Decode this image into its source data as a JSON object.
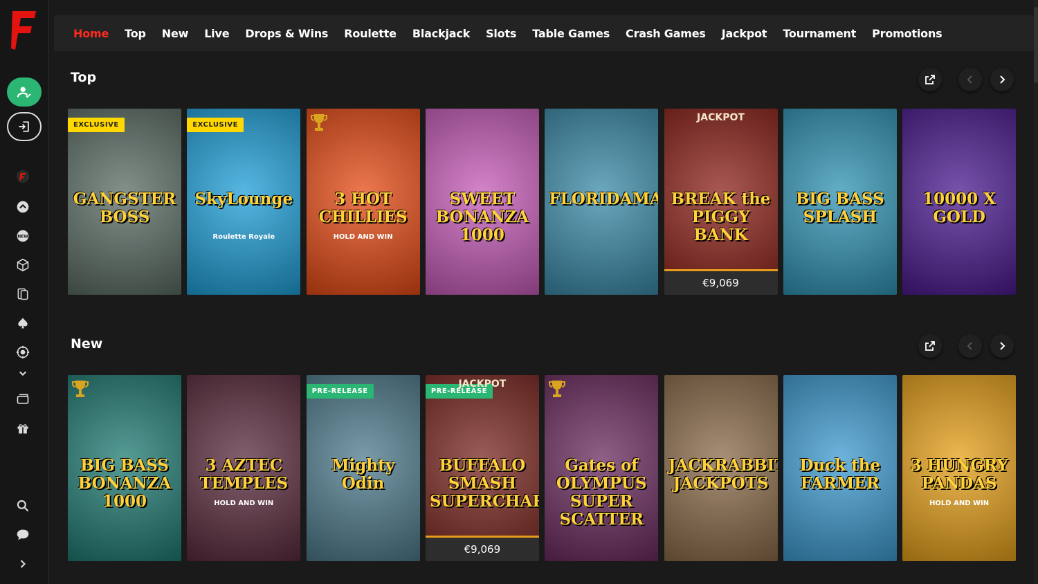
{
  "nav": {
    "items": [
      "Home",
      "Top",
      "New",
      "Live",
      "Drops & Wins",
      "Roulette",
      "Blackjack",
      "Slots",
      "Table Games",
      "Crash Games",
      "Jackpot",
      "Tournament",
      "Promotions"
    ],
    "active": "Home"
  },
  "sidebar": {
    "logo_letter": "F",
    "icons": [
      "account-icon",
      "login-icon",
      "brand-icon",
      "top-icon",
      "new-icon",
      "cube-icon",
      "cards-icon",
      "spade-icon",
      "roulette-icon",
      "chevron-down-icon",
      "tickets-icon",
      "gift-icon",
      "search-icon",
      "chat-icon",
      "expand-icon"
    ]
  },
  "sections": [
    {
      "title": "Top",
      "games": [
        {
          "title": "GANGSTER BOSS",
          "badge": "EXCLUSIVE",
          "bg": "#5a6b63"
        },
        {
          "title": "SkyLounge",
          "subtitle": "Roulette Royale",
          "badge": "EXCLUSIVE",
          "bg": "#1e9fd8"
        },
        {
          "title": "3 HOT CHILLIES",
          "subtitle": "HOLD AND WIN",
          "trophy": true,
          "bg": "#e64a14"
        },
        {
          "title": "SWEET BONANZA 1000",
          "bg": "#c65bb8"
        },
        {
          "title": "FLORIDAMAN",
          "bg": "#3a8aa8"
        },
        {
          "title": "BREAK the PIGGY BANK",
          "jackpot_label": "JACKPOT",
          "jackpot_value": "€9,069",
          "bg": "#8c2118"
        },
        {
          "title": "BIG BASS SPLASH",
          "bg": "#2f93b3"
        },
        {
          "title": "10000 X GOLD",
          "bg": "#4a1a8f"
        }
      ]
    },
    {
      "title": "New",
      "games": [
        {
          "title": "BIG BASS BONANZA 1000",
          "trophy": true,
          "bg": "#1f7a72"
        },
        {
          "title": "3 AZTEC TEMPLES",
          "subtitle": "HOLD AND WIN",
          "bg": "#5a2a3c"
        },
        {
          "title": "Mighty Odin",
          "badge": "PRE-RELEASE",
          "bg": "#4d7a8c"
        },
        {
          "title": "BUFFALO SMASH SUPERCHARGED",
          "badge": "PRE-RELEASE",
          "jackpot_label": "JACKPOT",
          "jackpot_value": "€9,069",
          "bg": "#7a2620"
        },
        {
          "title": "Gates of OLYMPUS SUPER SCATTER",
          "trophy": true,
          "bg": "#6a2a5e"
        },
        {
          "title": "JACKRABBIT JACKPOTS",
          "bg": "#8a6a48"
        },
        {
          "title": "Duck the FARMER",
          "bg": "#3d9ad0"
        },
        {
          "title": "3 HUNGRY PANDAS",
          "subtitle": "HOLD AND WIN",
          "bg": "#e6a018"
        }
      ]
    }
  ],
  "colors": {
    "accent": "#ff2a1f",
    "background": "#1a1a1a",
    "nav_bg": "#232323",
    "account_green": "#2bb673"
  }
}
